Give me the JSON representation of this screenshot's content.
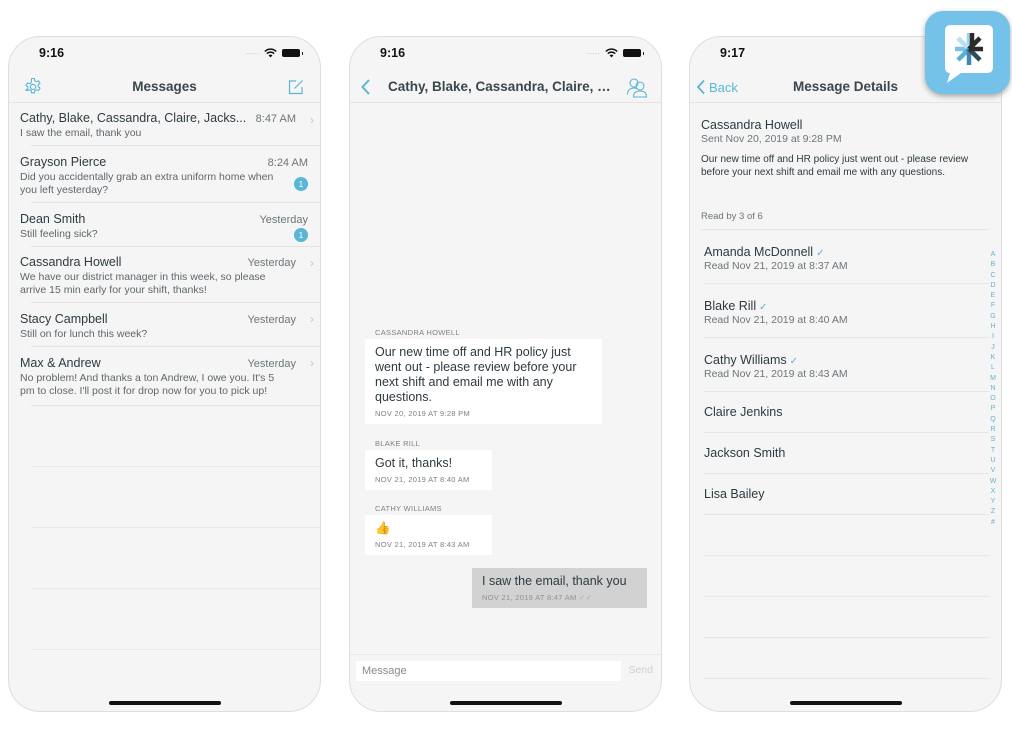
{
  "colors": {
    "accent": "#5ab6d5",
    "background": "#f5f5f5",
    "outgoing_bubble": "#d2d2d2",
    "app_icon": "#74c2ea"
  },
  "screen1": {
    "status_time": "9:16",
    "title": "Messages",
    "settings_icon": "gear-icon",
    "compose_icon": "compose-icon",
    "conversations": [
      {
        "name": "Cathy, Blake, Cassandra, Claire, Jacks...",
        "time": "8:47 AM",
        "preview": "I saw the email, thank you",
        "unread": null,
        "chevron": true
      },
      {
        "name": "Grayson Pierce",
        "time": "8:24 AM",
        "preview": "Did you accidentally grab an extra uniform home when you left yesterday?",
        "unread": "1",
        "chevron": false
      },
      {
        "name": "Dean  Smith",
        "time": "Yesterday",
        "preview": "Still feeling sick?",
        "unread": "1",
        "chevron": false
      },
      {
        "name": "Cassandra Howell",
        "time": "Yesterday",
        "preview": "We have our district manager in this week, so please arrive 15 min early for your shift, thanks!",
        "unread": null,
        "chevron": true
      },
      {
        "name": "Stacy Campbell",
        "time": "Yesterday",
        "preview": "Still on for lunch this week?",
        "unread": null,
        "chevron": true
      },
      {
        "name": "Max & Andrew",
        "time": "Yesterday",
        "preview": "No problem! And thanks a ton Andrew, I owe you. It's 5 pm to close. I'll post it for drop now for you to pick up!",
        "unread": null,
        "chevron": true
      }
    ]
  },
  "screen2": {
    "status_time": "9:16",
    "title": "Cathy, Blake, Cassandra, Claire, Jac...",
    "back_icon": "chevron-left-icon",
    "members_icon": "group-icon",
    "messages": [
      {
        "sender": "CASSANDRA HOWELL",
        "text": "Our new time off and HR policy just went out - please review before your next shift and email me with any questions.",
        "date": "NOV 20, 2019 AT 9:28 PM",
        "outgoing": false
      },
      {
        "sender": "BLAKE RILL",
        "text": "Got it, thanks!",
        "date": "NOV 21, 2019 AT 8:40 AM",
        "outgoing": false
      },
      {
        "sender": "CATHY WILLIAMS",
        "text": "👍",
        "date": "NOV 21, 2019 AT 8:43 AM",
        "outgoing": false
      },
      {
        "sender": "",
        "text": "I saw the email, thank you",
        "date": "NOV 21, 2019 AT 8:47 AM",
        "outgoing": true,
        "read_receipt": "✓✓"
      }
    ],
    "composer": {
      "placeholder": "Message",
      "send_label": "Send"
    }
  },
  "screen3": {
    "status_time": "9:17",
    "back_label": "Back",
    "title": "Message Details",
    "author": "Cassandra Howell",
    "sent": "Sent Nov 20, 2019 at 9:28 PM",
    "body": "Our new time off and HR policy just went out - please review before your next shift and email me with any questions.",
    "read_by": "Read by 3 of 6",
    "recipients": [
      {
        "name": "Amanda McDonnell",
        "read": "Read Nov 21, 2019 at 8:37 AM"
      },
      {
        "name": "Blake Rill",
        "read": "Read Nov 21, 2019 at 8:40 AM"
      },
      {
        "name": "Cathy Williams",
        "read": "Read Nov 21, 2019 at 8:43 AM"
      },
      {
        "name": "Claire Jenkins",
        "read": null
      },
      {
        "name": "Jackson  Smith",
        "read": null
      },
      {
        "name": "Lisa Bailey",
        "read": null
      }
    ],
    "alpha_index": [
      "A",
      "B",
      "C",
      "D",
      "E",
      "F",
      "G",
      "H",
      "I",
      "J",
      "K",
      "L",
      "M",
      "N",
      "O",
      "P",
      "Q",
      "R",
      "S",
      "T",
      "U",
      "V",
      "W",
      "X",
      "Y",
      "Z",
      "#"
    ]
  },
  "app_icon": {
    "name": "app-logo-icon"
  }
}
